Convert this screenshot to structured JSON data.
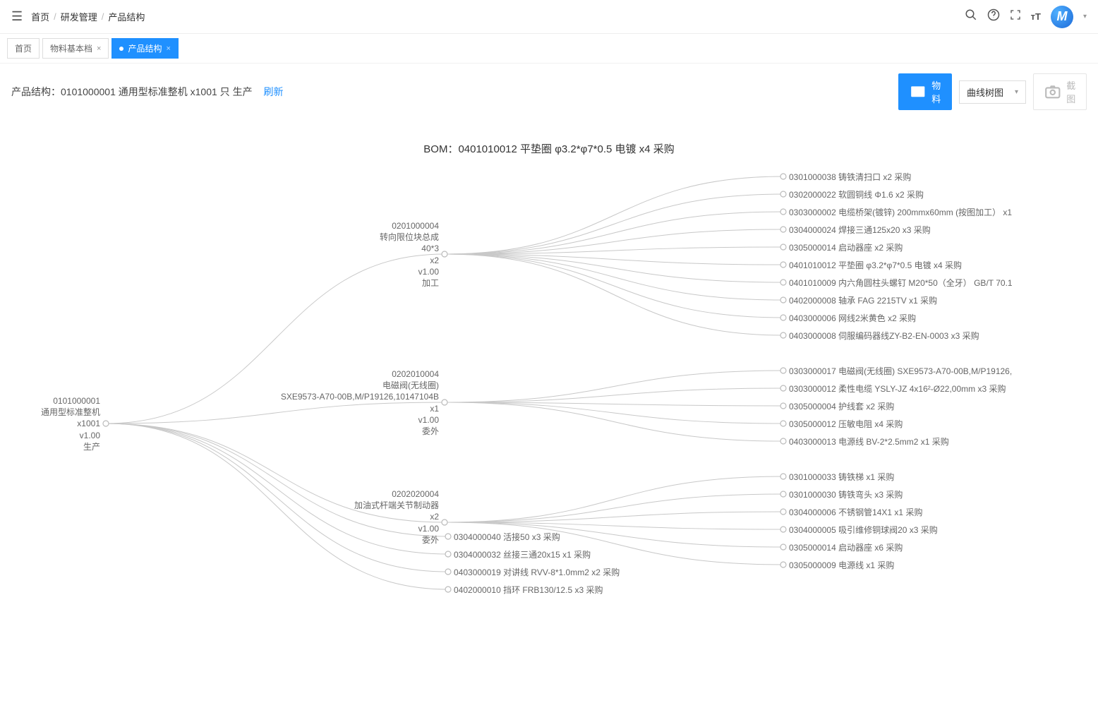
{
  "breadcrumb": {
    "home": "首页",
    "rd": "研发管理",
    "ps": "产品结构"
  },
  "tabs": {
    "home": "首页",
    "material": "物料基本档",
    "ps": "产品结构"
  },
  "pageTitle": {
    "prefix": "产品结构：",
    "text": "0101000001 通用型标准整机 x1001 只 生产",
    "refresh": "刷新"
  },
  "actions": {
    "material": "物料",
    "view": "曲线树图",
    "screenshot": "截图"
  },
  "bomTitle": "BOM：0401010012 平垫圈 φ3.2*φ7*0.5 电镀 x4 采购",
  "root": {
    "lines": [
      "0101000001",
      "通用型标准整机",
      "x1001",
      "v1.00",
      "生产"
    ]
  },
  "mid": {
    "n1": {
      "lines": [
        "0201000004",
        "转向限位块总成",
        "40*3",
        "x2",
        "v1.00",
        "加工"
      ]
    },
    "n2": {
      "lines": [
        "0202010004",
        "电磁阀(无线圈)",
        "SXE9573-A70-00B,M/P19126,10147104B",
        "x1",
        "v1.00",
        "委外"
      ]
    },
    "n3": {
      "lines": [
        "0202020004",
        "加油式杆端关节制动器",
        "",
        "x2",
        "v1.00",
        "委外"
      ]
    }
  },
  "leavesA": [
    "0301000038 铸铁清扫口  x2 采购",
    "0302000022 软圆铜线 Φ1.6  x2 采购",
    "0303000002 电缆桥架(镀锌) 200mmx60mm (按图加工）  x1 ",
    "0304000024 焊接三通125x20  x3 采购",
    "0305000014 启动器座  x2 采购",
    "0401010012 平垫圈 φ3.2*φ7*0.5  电镀 x4 采购",
    "0401010009 内六角圆柱头螺钉 M20*50（全牙） GB/T 70.1",
    "0402000008 轴承 FAG 2215TV x1 采购",
    "0403000006 网线2米黄色  x2 采购",
    "0403000008 伺服编码器线ZY-B2-EN-0003  x3 采购"
  ],
  "leavesB": [
    "0303000017 电磁阀(无线圈) SXE9573-A70-00B,M/P19126,",
    "0303000012 柔性电缆 YSLY-JZ 4x16²-Ø22,00mm x3 采购",
    "0305000004 护线套  x2 采购",
    "0305000012 压敏电阻  x4 采购",
    "0403000013 电源线 BV-2*2.5mm2  x1 采购"
  ],
  "leavesC": [
    "0301000033 铸铁梯  x1 采购",
    "0301000030 铸铁弯头  x3 采购",
    "0304000006 不锈钢管14X1  x1 采购",
    "0304000005 吸引维修铜球阀20  x3 采购",
    "0305000014 启动器座  x6 采购",
    "0305000009 电源线  x1 采购"
  ],
  "leavesD": [
    "0304000040 活接50  x3 采购",
    "0304000032 丝接三通20x15  x1 采购",
    "0403000019 对讲线 RVV-8*1.0mm2  x2 采购",
    "0402000010 挡环 FRB130/12.5 x3 采购"
  ]
}
